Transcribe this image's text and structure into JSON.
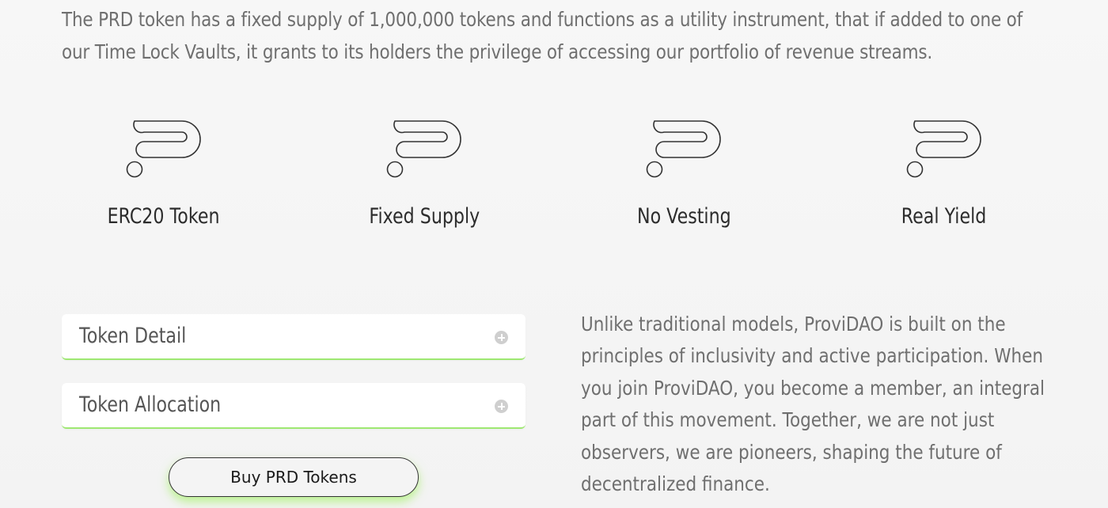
{
  "intro": {
    "text": "The PRD token has a fixed supply of 1,000,000 tokens and functions as a utility instrument, that if added to one of our Time Lock Vaults, it grants to its holders the privilege of accessing our portfolio of revenue streams."
  },
  "features": [
    {
      "icon": "provi-logo-icon",
      "label": "ERC20 Token"
    },
    {
      "icon": "provi-logo-icon",
      "label": "Fixed Supply"
    },
    {
      "icon": "provi-logo-icon",
      "label": "No Vesting"
    },
    {
      "icon": "provi-logo-icon",
      "label": "Real Yield"
    }
  ],
  "accordions": [
    {
      "title": "Token Detail",
      "icon": "plus-circle-icon"
    },
    {
      "title": "Token Allocation",
      "icon": "plus-circle-icon"
    }
  ],
  "buy_button": {
    "label": "Buy PRD Tokens"
  },
  "description": {
    "text": "Unlike traditional models, ProviDAO is built on the principles of inclusivity and active participation. When you join ProviDAO, you become a member, an integral part of this movement. Together, we are not just observers, we are pioneers, shaping the future of decentralized finance."
  },
  "colors": {
    "accent_green": "#9ee872",
    "text_gray": "#6f6f6f",
    "heading_dark": "#2c2c2c"
  }
}
